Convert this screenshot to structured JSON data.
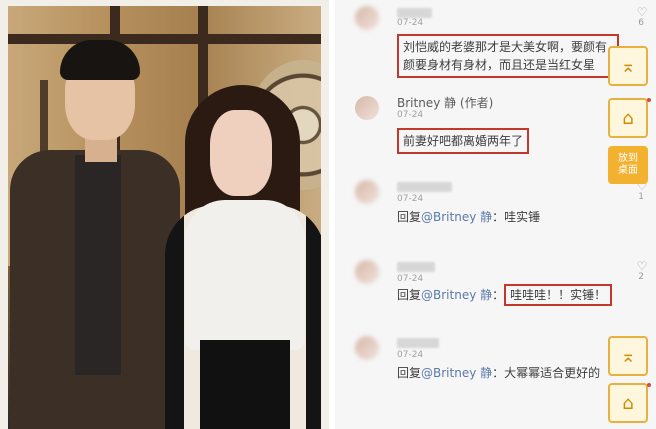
{
  "comments": [
    {
      "date": "07-24",
      "text": "刘恺威的老婆那才是大美女啊，要颜有颜要身材有身材，而且还是当红女星",
      "likes": "6"
    },
    {
      "user": "Britney 静 (作者)",
      "date": "07-24",
      "text": "前妻好吧都离婚两年了"
    },
    {
      "date": "07-24",
      "reply_prefix": "回复",
      "reply_mention": "@Britney 静",
      "reply_text": "：哇实锤",
      "likes": "1"
    },
    {
      "date": "07-24",
      "reply_prefix": "回复",
      "reply_mention": "@Britney 静",
      "reply_text": "：",
      "reply_highlight": "哇哇哇！！实锤！",
      "likes": "2"
    },
    {
      "date": "07-24",
      "reply_prefix": "回复",
      "reply_mention": "@Britney 静",
      "reply_text": "：大幂幂适合更好的"
    }
  ],
  "floating_buttons": {
    "top_icon": "arrow-up-to-top-icon",
    "home_icon": "home-icon",
    "desktop_label": "放到\n桌面",
    "top2_icon": "arrow-up-to-top-icon",
    "home2_icon": "home-icon"
  },
  "colors": {
    "highlight_border": "#c0392b",
    "accent": "#f2b12f",
    "mention": "#5b7aa8"
  }
}
